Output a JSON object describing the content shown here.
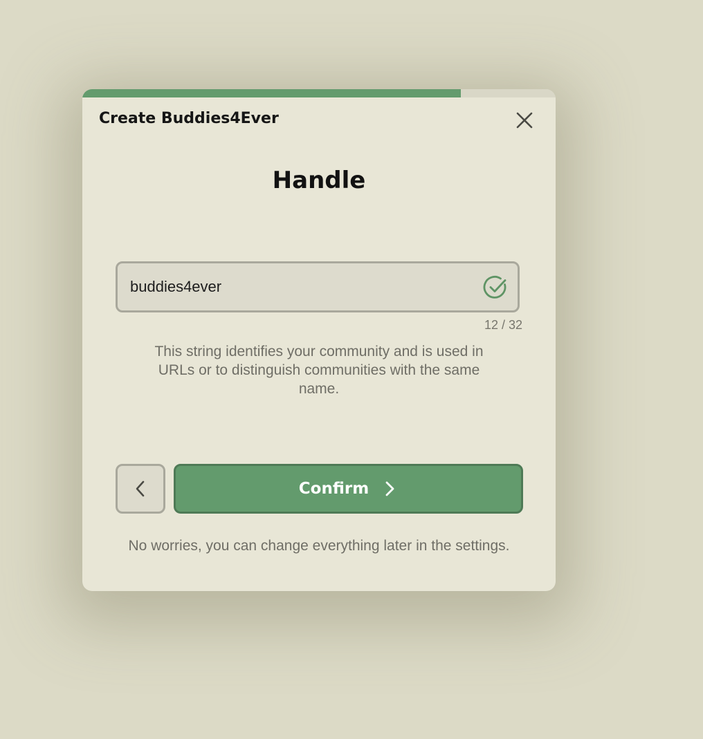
{
  "modal": {
    "title": "Create Buddies4Ever",
    "progress_percent": 80,
    "step_title": "Handle",
    "close_icon": "close-icon"
  },
  "handle_input": {
    "value": "buddies4ever",
    "counter": "12 / 32",
    "status_icon": "check-circle-icon",
    "status_color": "#5f9465"
  },
  "help": {
    "text": "This string identifies your community and is used in URLs or to distinguish communities with the same name."
  },
  "actions": {
    "back_icon": "chevron-left-icon",
    "confirm_label": "Confirm",
    "confirm_icon": "chevron-right-icon"
  },
  "footer": {
    "note": "No worries, you can change everything later in the settings."
  },
  "colors": {
    "accent": "#639b6d",
    "accent_border": "#4e7a56",
    "background": "#dcdac6",
    "panel": "#e8e6d6"
  }
}
